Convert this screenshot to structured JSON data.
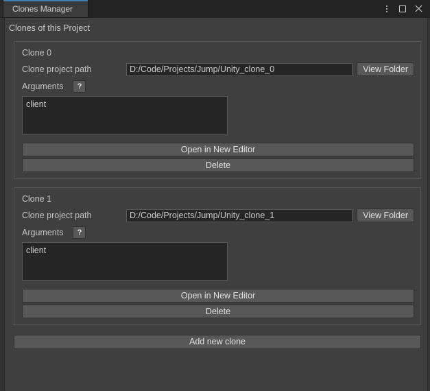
{
  "window": {
    "tab_label": "Clones Manager",
    "accent_color": "#3d7eb5",
    "controls": {
      "menu_label": "",
      "maximize_label": "",
      "close_label": ""
    }
  },
  "main": {
    "page_title": "Clones of this Project",
    "path_label": "Clone project path",
    "args_label": "Arguments",
    "help_label": "?",
    "view_folder_label": "View Folder",
    "open_editor_label": "Open in New Editor",
    "delete_label": "Delete",
    "add_clone_label": "Add new clone",
    "clones": [
      {
        "title": "Clone 0",
        "path": "D:/Code/Projects/Jump/Unity_clone_0",
        "arguments": "client"
      },
      {
        "title": "Clone 1",
        "path": "D:/Code/Projects/Jump/Unity_clone_1",
        "arguments": "client"
      }
    ]
  }
}
